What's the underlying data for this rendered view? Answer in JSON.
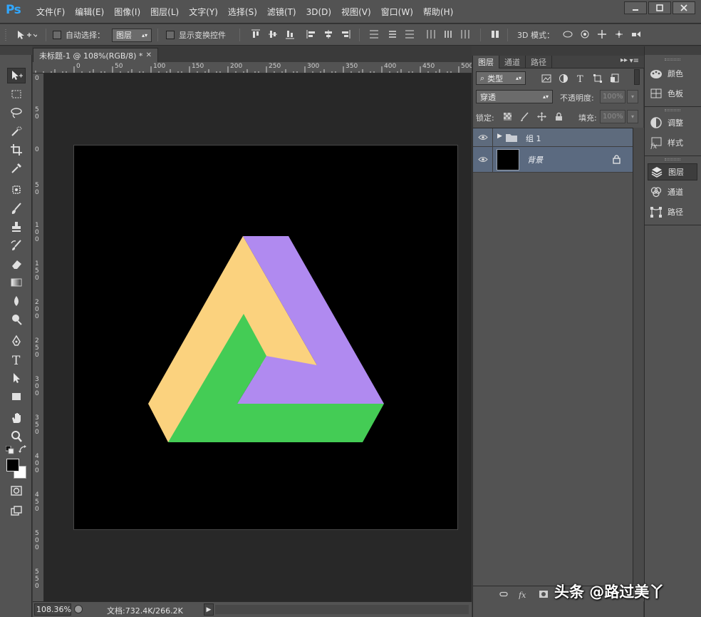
{
  "app": {
    "logo": "Ps",
    "menu": [
      "文件(F)",
      "编辑(E)",
      "图像(I)",
      "图层(L)",
      "文字(Y)",
      "选择(S)",
      "滤镜(T)",
      "3D(D)",
      "视图(V)",
      "窗口(W)",
      "帮助(H)"
    ]
  },
  "options_bar": {
    "auto_select_label": "自动选择：",
    "auto_select_target": "图层",
    "show_transform_label": "显示变换控件",
    "mode_3d_label": "3D 模式："
  },
  "document": {
    "tab_title": "未标题-1 @ 108%(RGB/8) *",
    "zoom": "108.36%",
    "doc_info": "文档:732.4K/266.2K",
    "canvas_color": "#000000",
    "ruler_top_labels": [
      "0",
      "50",
      "100",
      "150",
      "200",
      "250",
      "300",
      "350",
      "400",
      "450",
      "500"
    ],
    "ruler_left_labels": [
      "0",
      "50",
      "0",
      "50",
      "100",
      "150",
      "200",
      "250",
      "300",
      "350",
      "400",
      "450",
      "500",
      "550"
    ]
  },
  "artwork": {
    "name": "penrose-triangle",
    "colors": {
      "yellow": "#fbd27e",
      "purple": "#b08af0",
      "green": "#44cc55"
    }
  },
  "layers_panel": {
    "tabs": [
      "图层",
      "通道",
      "路径"
    ],
    "active_tab": "图层",
    "filter_kind": "类型",
    "blend_mode": "穿透",
    "opacity_label": "不透明度:",
    "opacity_value": "100%",
    "lock_label": "锁定:",
    "fill_label": "填充:",
    "fill_value": "100%",
    "layers": [
      {
        "name": "组 1",
        "type": "group",
        "visible": true
      },
      {
        "name": "背景",
        "type": "background",
        "visible": true,
        "locked": true
      }
    ]
  },
  "right_dock": {
    "items": [
      "颜色",
      "色板",
      "调整",
      "样式",
      "图层",
      "通道",
      "路径"
    ],
    "active_item": "图层"
  },
  "watermark": "头条 @路过美丫"
}
